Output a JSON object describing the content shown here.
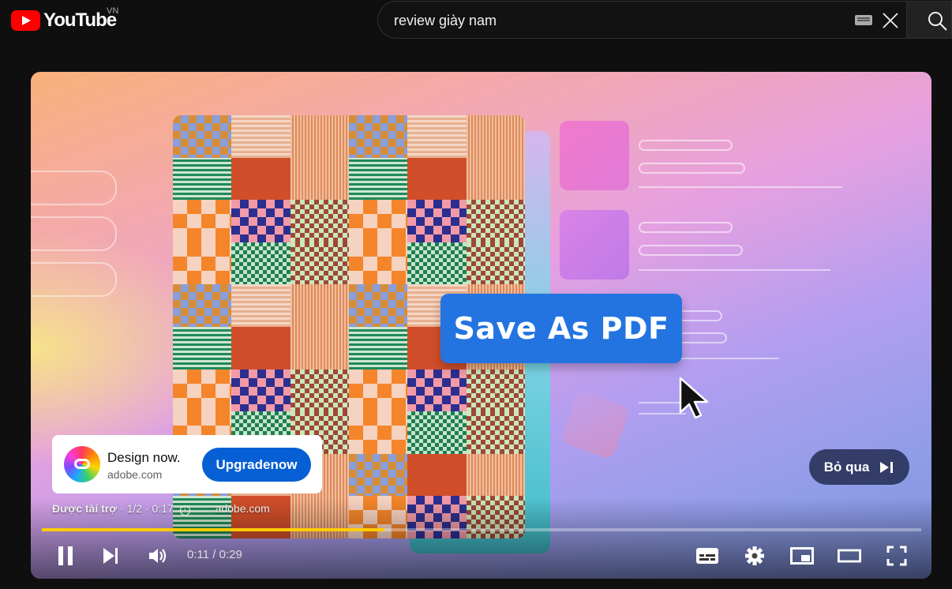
{
  "header": {
    "logo_text": "YouTube",
    "country_code": "VN",
    "search_value": "review giày nam"
  },
  "video": {
    "overlay_button_text": "Save As PDF",
    "ad": {
      "title": "Design now.",
      "domain": "adobe.com",
      "cta_label": "Upgradenow",
      "sponsored_label": "Được tài trợ",
      "ad_position": "1/2",
      "ad_remaining": "0:17",
      "footer_domain": "adobe.com"
    },
    "skip_label": "Bỏ qua",
    "time_current": "0:11",
    "time_separator": " / ",
    "time_total": "0:29",
    "progress_fraction": 0.39
  },
  "icons": [
    "youtube-logo-icon",
    "keyboard-icon",
    "clear-icon",
    "search-icon",
    "creative-cloud-icon",
    "info-icon",
    "skip-next-icon",
    "pause-icon",
    "next-icon",
    "volume-icon",
    "subtitles-icon",
    "settings-icon",
    "miniplayer-icon",
    "theater-icon",
    "fullscreen-icon"
  ],
  "colors": {
    "brand_red": "#ff0000",
    "cta_blue": "#065fd4",
    "progress_yellow": "#ffcc00",
    "pdf_button_blue": "#2374e1"
  }
}
